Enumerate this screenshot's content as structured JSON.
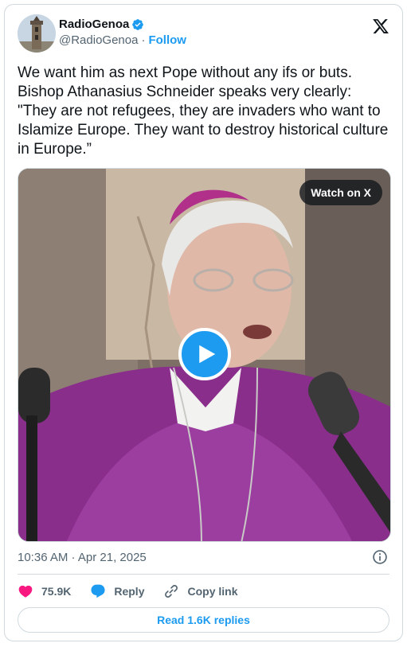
{
  "author": {
    "name": "RadioGenoa",
    "handle": "@RadioGenoa",
    "separator": "·",
    "follow_label": "Follow"
  },
  "tweet": {
    "text": "We want him as next Pope without any ifs or buts.\nBishop Athanasius Schneider speaks very clearly:\n\"They are not refugees, they are invaders who want to Islamize Europe. They want to destroy historical culture in Europe.”"
  },
  "media": {
    "watch_label": "Watch on X"
  },
  "meta": {
    "timestamp": "10:36 AM · Apr 21, 2025"
  },
  "actions": {
    "likes": "75.9K",
    "reply_label": "Reply",
    "copy_link_label": "Copy link"
  },
  "read_replies_label": "Read 1.6K replies",
  "colors": {
    "accent": "#1d9bf0",
    "like": "#f91880",
    "text": "#0f1419",
    "muted": "#536471",
    "border": "#cfd9de"
  },
  "icons": {
    "avatar": "tower-avatar",
    "verified": "verified-badge-icon",
    "logo": "x-logo-icon",
    "play": "play-icon",
    "info": "info-icon",
    "like": "heart-icon",
    "reply": "speech-bubble-icon",
    "copy": "link-icon"
  }
}
